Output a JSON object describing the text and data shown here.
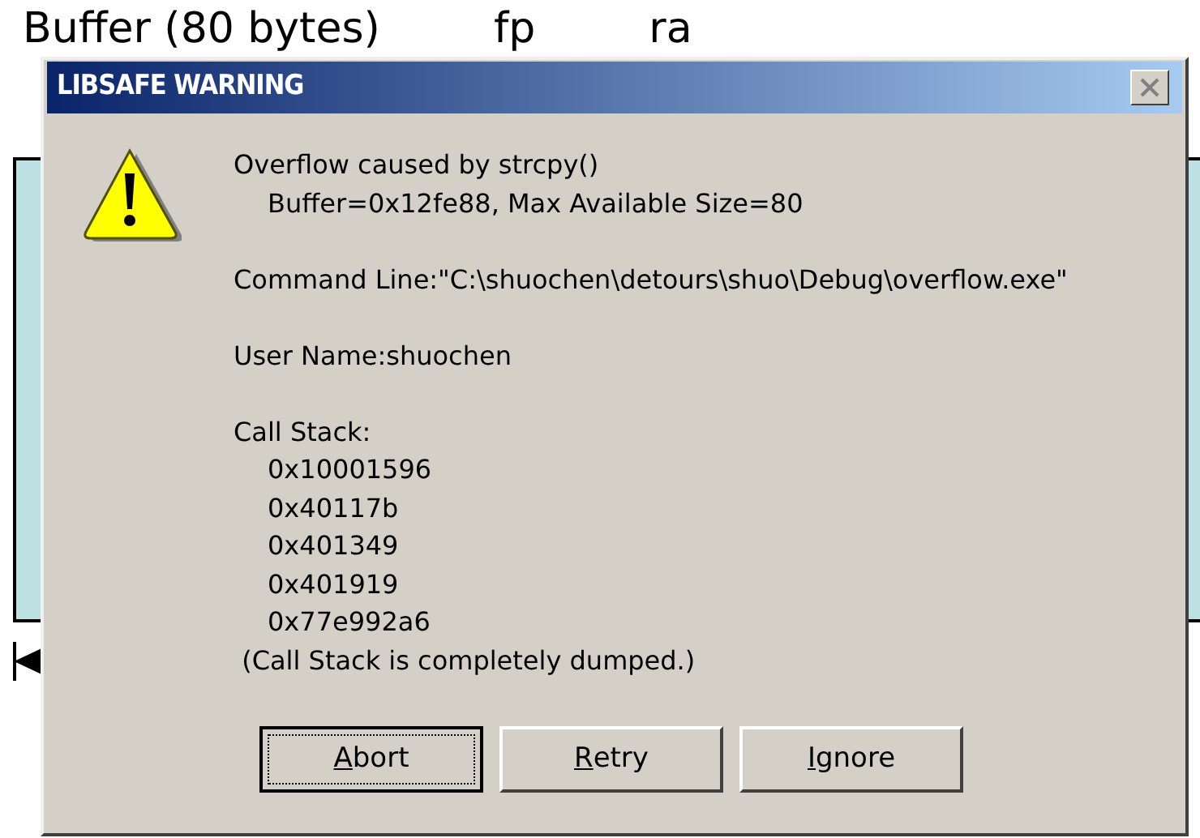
{
  "slide": {
    "title_parts": [
      "Buffer (80 bytes)",
      "fp",
      "ra"
    ]
  },
  "dialog": {
    "title": "LIBSAFE WARNING",
    "paragraphs": [
      {
        "lines": [
          {
            "text": "Overflow caused by strcpy()",
            "indent": false
          },
          {
            "text": "Buffer=0x12fe88, Max Available Size=80",
            "indent": true
          }
        ]
      },
      {
        "lines": [
          {
            "text": "Command Line:\"C:\\shuochen\\detours\\shuo\\Debug\\overflow.exe\"",
            "indent": false
          }
        ]
      },
      {
        "lines": [
          {
            "text": "User Name:shuochen",
            "indent": false
          }
        ]
      },
      {
        "lines": [
          {
            "text": "Call Stack:",
            "indent": false
          },
          {
            "text": "0x10001596",
            "indent": true
          },
          {
            "text": "0x40117b",
            "indent": true
          },
          {
            "text": "0x401349",
            "indent": true
          },
          {
            "text": "0x401919",
            "indent": true
          },
          {
            "text": "0x77e992a6",
            "indent": true
          },
          {
            "text": " (Call Stack is completely dumped.)",
            "indent": false
          }
        ]
      }
    ],
    "buttons": [
      {
        "label": "Abort",
        "selected": true
      },
      {
        "label": "Retry",
        "selected": false
      },
      {
        "label": "Ignore",
        "selected": false
      }
    ]
  }
}
